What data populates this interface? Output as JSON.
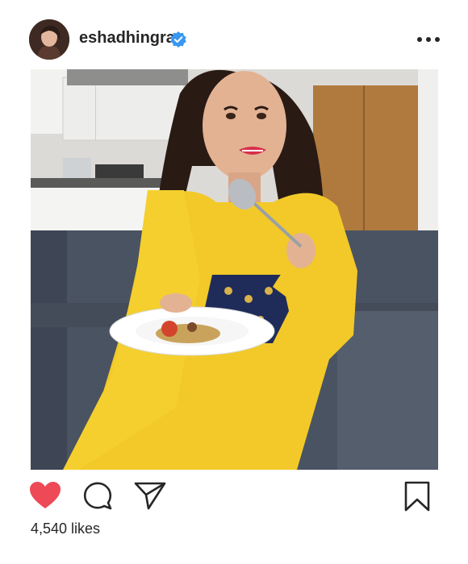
{
  "post": {
    "username": "eshadhingra",
    "verified": true,
    "likes_text": "4,540 likes",
    "liked": true
  },
  "icons": {
    "avatar": "profile-avatar",
    "verified": "verified-badge-icon",
    "more": "more-options-icon",
    "like": "heart-icon",
    "comment": "comment-icon",
    "share": "send-icon",
    "save": "bookmark-icon"
  },
  "colors": {
    "like": "#ed4956",
    "verified": "#3897f0",
    "text": "#262626"
  }
}
